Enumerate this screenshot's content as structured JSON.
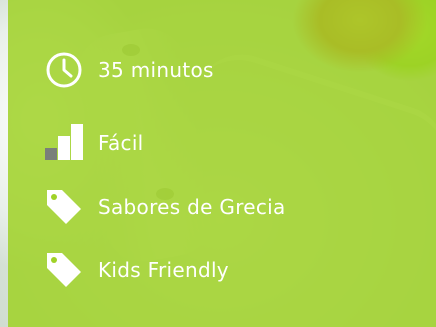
{
  "details": {
    "items": [
      {
        "icon": "clock-icon",
        "label": "35 minutos"
      },
      {
        "icon": "difficulty-bars-icon",
        "label": "Fácil"
      },
      {
        "icon": "tag-icon",
        "label": "Sabores de Grecia"
      },
      {
        "icon": "tag-icon",
        "label": "Kids Friendly"
      }
    ]
  },
  "colors": {
    "panel": "#a0d228",
    "text": "#ffffff",
    "icon_muted": "#7a7f7a"
  }
}
